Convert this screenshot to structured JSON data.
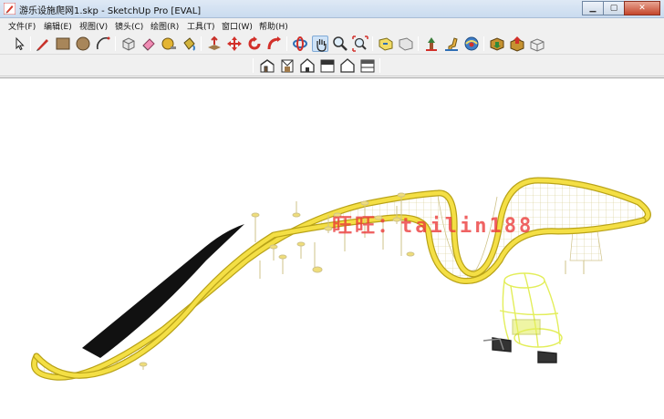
{
  "window": {
    "title": "游乐设施爬网1.skp - SketchUp Pro [EVAL]",
    "app_icon": "sketchup-pencil-icon",
    "buttons": [
      "minimize-icon",
      "maximize-icon",
      "close-icon"
    ]
  },
  "menu": {
    "items": [
      "文件(F)",
      "编辑(E)",
      "视图(V)",
      "镜头(C)",
      "绘图(R)",
      "工具(T)",
      "窗口(W)",
      "帮助(H)"
    ]
  },
  "toolbar": {
    "tools": [
      "select-arrow-icon",
      "pencil-line-icon",
      "rectangle-icon",
      "circle-icon",
      "arc-icon",
      "make-component-icon",
      "eraser-icon",
      "tape-measure-icon",
      "paint-bucket-icon",
      "push-pull-icon",
      "move-icon",
      "rotate-icon",
      "follow-me-icon",
      "orbit-icon",
      "pan-hand-icon",
      "zoom-icon",
      "zoom-extents-icon",
      "previous-view-icon",
      "next-view-icon",
      "position-camera-icon",
      "walk-icon",
      "look-around-icon",
      "get-models-icon",
      "share-model-icon",
      "share-component-icon"
    ],
    "active_tool": "pan-hand-icon"
  },
  "views": {
    "items": [
      "iso-view-icon",
      "top-view-icon",
      "front-view-icon",
      "right-view-icon",
      "back-view-icon",
      "left-view-icon"
    ]
  },
  "viewport": {
    "watermark": "旺旺：tailin188",
    "model_colors": {
      "frame": "#f2d93b",
      "frame_edge": "#b9a318",
      "net": "#d8cf9a",
      "mat": "#111111",
      "swing": "#e3ee5a"
    }
  }
}
